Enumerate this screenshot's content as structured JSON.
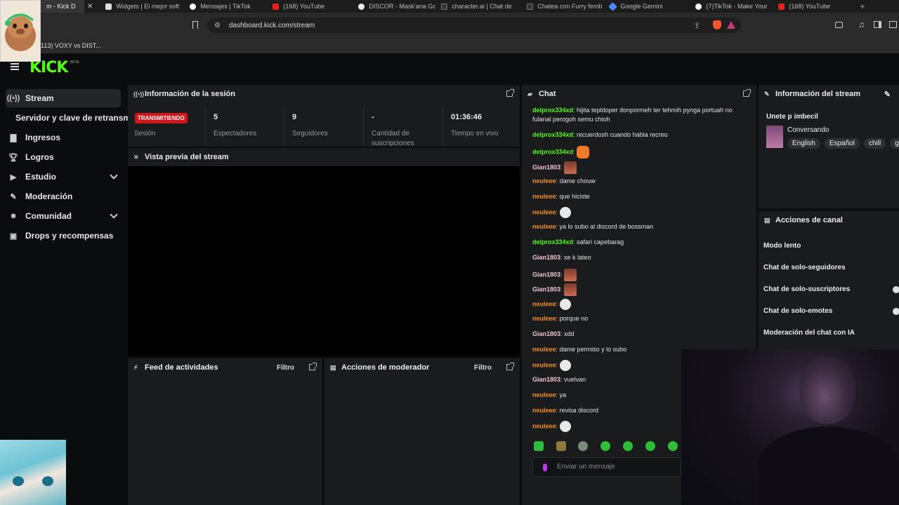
{
  "browser": {
    "tabs": [
      {
        "label": "m - Kick D",
        "active": true
      },
      {
        "label": "Widgets | El mejor soft"
      },
      {
        "label": "Mensajes | TikTok"
      },
      {
        "label": "(168) YouTube"
      },
      {
        "label": "DISCOR - Mask'ana Go"
      },
      {
        "label": "character.ai | Chat de"
      },
      {
        "label": "Chatea con Furry femb"
      },
      {
        "label": "Google Gemini"
      },
      {
        "label": "(7)TikTok - Make Your"
      },
      {
        "label": "(168) YouTube"
      }
    ],
    "new_tab": "+",
    "url": "dashboard.kick.com/stream",
    "bookmark": "113) VOXY vs DIST..."
  },
  "kick": {
    "logo": "KICK",
    "beta": "BETA"
  },
  "sidebar": {
    "items": [
      {
        "label": "Stream",
        "icon": "broadcast-icon",
        "active": true
      },
      {
        "label": "Servidor y clave de retransm",
        "icon": ""
      },
      {
        "label": "Ingresos",
        "icon": "bar-chart-icon"
      },
      {
        "label": "Logros",
        "icon": "trophy-icon"
      },
      {
        "label": "Estudio",
        "icon": "studio-icon",
        "chevron": true
      },
      {
        "label": "Moderación",
        "icon": "wrench-icon"
      },
      {
        "label": "Comunidad",
        "icon": "community-icon",
        "chevron": true
      },
      {
        "label": "Drops y recompensas",
        "icon": "drops-icon"
      }
    ]
  },
  "session": {
    "title": "Información de la sesión",
    "badge": "TRANSMITIENDO",
    "badge_label": "Sesión",
    "stats": [
      {
        "value": "5",
        "label": "Espectadores"
      },
      {
        "value": "9",
        "label": "Seguidores"
      },
      {
        "value": "-",
        "label": "Cantidad de suscripciones"
      },
      {
        "value": "01:36:46",
        "label": "Tiempo en vivo"
      }
    ]
  },
  "preview": {
    "title": "Vista previa del stream"
  },
  "activity": {
    "title": "Feed de actividades",
    "filter": "Filtro"
  },
  "modactions": {
    "title": "Acciones de moderador",
    "filter": "Filtro"
  },
  "chat": {
    "title": "Chat",
    "messages": [
      {
        "user": "delprox334xd",
        "color": "#53fc18",
        "text": "hijita tepldoper donpormeh ter tehmih pynga portuah no fulanal perogoh semu chioh"
      },
      {
        "user": "delprox334xd",
        "color": "#53fc18",
        "text": "recuerdosh cuando habia recreo"
      },
      {
        "user": "delprox334xd",
        "color": "#53fc18",
        "text": "",
        "emote": "cat"
      },
      {
        "user": "Gian1803",
        "color": "#f0c4d0",
        "text": "",
        "emote": "face"
      },
      {
        "user": "neuleee",
        "color": "#f58f26",
        "text": "dame chouw"
      },
      {
        "user": "neuleee",
        "color": "#f58f26",
        "text": "que hiciste"
      },
      {
        "user": "neuleee",
        "color": "#f58f26",
        "text": "",
        "emote": "skull"
      },
      {
        "user": "neuleee",
        "color": "#f58f26",
        "text": "ya lo subo al discord de bossman"
      },
      {
        "user": "delprox334xd",
        "color": "#53fc18",
        "text": "safari capebarag"
      },
      {
        "user": "Gian1803",
        "color": "#f0c4d0",
        "text": "se k lateo"
      },
      {
        "user": "Gian1803",
        "color": "#f0c4d0",
        "text": "",
        "emote": "face"
      },
      {
        "user": "Gian1803",
        "color": "#f0c4d0",
        "text": "",
        "emote": "face"
      },
      {
        "user": "neuleee",
        "color": "#f58f26",
        "text": "",
        "emote": "skull"
      },
      {
        "user": "neuleee",
        "color": "#f58f26",
        "text": "porque no"
      },
      {
        "user": "Gian1803",
        "color": "#f0c4d0",
        "text": "xdd"
      },
      {
        "user": "neuleee",
        "color": "#f58f26",
        "text": "dame permiso y lo subo"
      },
      {
        "user": "neuleee",
        "color": "#f58f26",
        "text": "",
        "emote": "skull"
      },
      {
        "user": "Gian1803",
        "color": "#f0c4d0",
        "text": "vuelvan"
      },
      {
        "user": "neuleee",
        "color": "#f58f26",
        "text": "ya"
      },
      {
        "user": "neuleee",
        "color": "#f58f26",
        "text": "revisa discord"
      },
      {
        "user": "neuleee",
        "color": "#f58f26",
        "text": "",
        "emote": "skull"
      }
    ],
    "input_placeholder": "Enviar un mensaje"
  },
  "stream_info": {
    "title": "Información del stream",
    "stream_title": "Unete p imbecil",
    "category": "Conversando",
    "tags": [
      "English",
      "Español",
      "chill",
      "gar"
    ]
  },
  "channel_actions": {
    "title": "Acciones de canal",
    "items": [
      "Modo lento",
      "Chat de solo-seguidores",
      "Chat de solo-suscriptores",
      "Chat de solo-emotes",
      "Moderación del chat con IA"
    ]
  },
  "colors": {
    "brand": "#53fc18",
    "live": "#d2161c",
    "panel": "#191b1c"
  }
}
